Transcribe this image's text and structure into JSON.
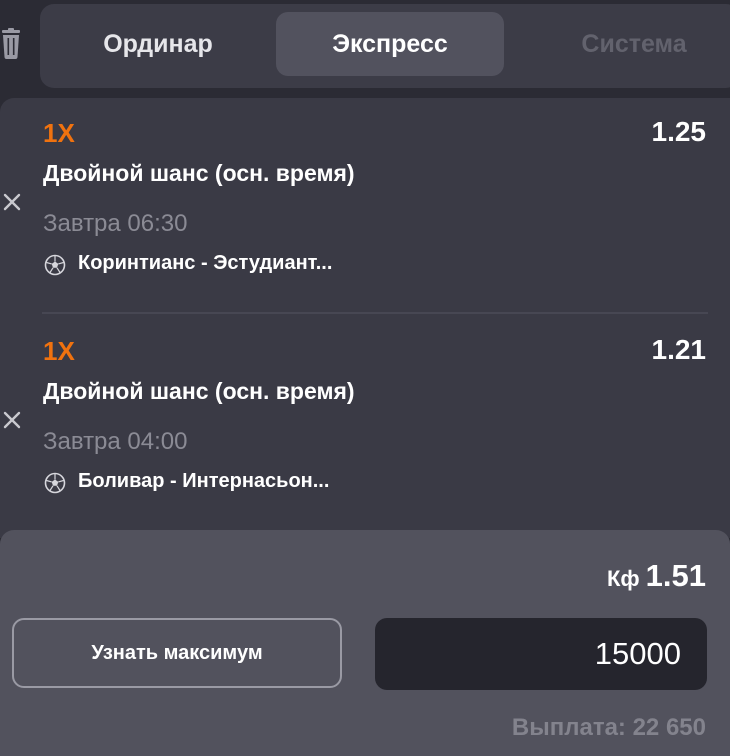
{
  "tabs": [
    {
      "label": "Ординар",
      "active": false
    },
    {
      "label": "Экспресс",
      "active": true
    },
    {
      "label": "Система",
      "active": false
    }
  ],
  "icons": {
    "trash": "trash-icon",
    "remove": "close-icon",
    "sport": "soccer-ball-icon"
  },
  "bets": [
    {
      "market": "1X",
      "odds": "1.25",
      "title": "Двойной шанс (осн. время)",
      "time": "Завтра 06:30",
      "match": "Коринтианс - Эстудиант..."
    },
    {
      "market": "1X",
      "odds": "1.21",
      "title": "Двойной шанс (осн. время)",
      "time": "Завтра 04:00",
      "match": "Боливар - Интернасьон..."
    }
  ],
  "footer": {
    "coef_label": "Кф",
    "coef_value": "1.51",
    "max_button_label": "Узнать максимум",
    "stake_value": "15000",
    "payout": "Выплата: 22 650"
  },
  "colors": {
    "accent": "#f0720f",
    "background": "#2b2b34",
    "panel": "#3a3a45",
    "footer": "#52525d"
  }
}
